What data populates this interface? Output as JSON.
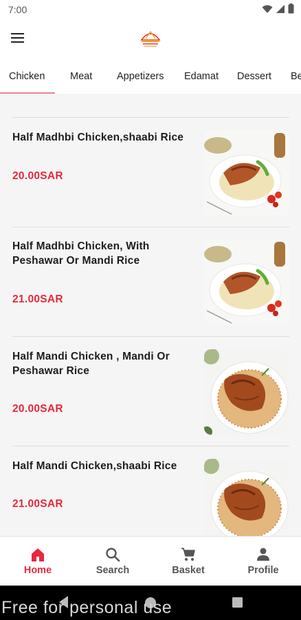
{
  "status": {
    "time": "7:00"
  },
  "header": {
    "menu_icon": "hamburger-menu-icon",
    "logo_icon": "restaurant-logo-icon"
  },
  "tabs": [
    {
      "label": "Chicken",
      "active": true
    },
    {
      "label": "Meat"
    },
    {
      "label": "Appetizers"
    },
    {
      "label": "Edamat"
    },
    {
      "label": "Dessert"
    },
    {
      "label": "Be"
    }
  ],
  "menu_items": [
    {
      "title": "Half  Madhbi Chicken,shaabi Rice",
      "price": "20.00SAR",
      "image_icon": "madhbi-chicken-plate-image"
    },
    {
      "title": "Half Madhbi Chicken, With Peshawar Or Mandi Rice",
      "price": "21.00SAR",
      "image_icon": "madhbi-chicken-plate-image"
    },
    {
      "title": "Half Mandi Chicken , Mandi Or Peshawar Rice",
      "price": "20.00SAR",
      "image_icon": "mandi-chicken-plate-image"
    },
    {
      "title": "Half Mandi Chicken,shaabi Rice",
      "price": "21.00SAR",
      "image_icon": "mandi-chicken-plate-image"
    }
  ],
  "bottom_nav": [
    {
      "label": "Home",
      "icon": "home-icon",
      "active": true
    },
    {
      "label": "Search",
      "icon": "search-icon"
    },
    {
      "label": "Basket",
      "icon": "cart-icon"
    },
    {
      "label": "Profile",
      "icon": "profile-icon"
    }
  ],
  "watermark": "Free for personal use",
  "colors": {
    "accent": "#e8283d",
    "tab_underline": "#f0828c",
    "background": "#f5f5f5"
  }
}
